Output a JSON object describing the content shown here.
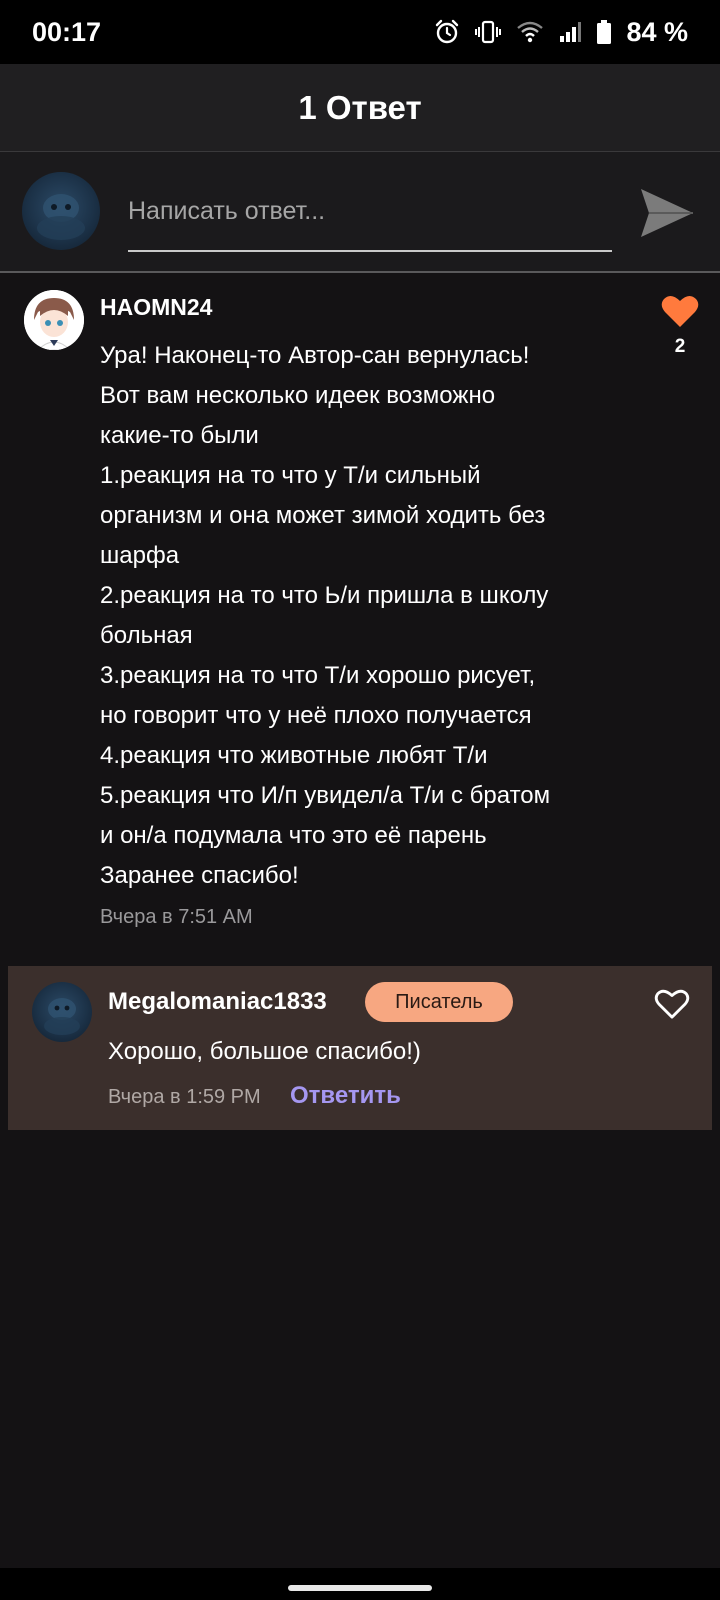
{
  "status_bar": {
    "time": "00:17",
    "battery": "84 %",
    "icons": [
      "alarm-icon",
      "vibrate-icon",
      "wifi-icon",
      "signal-icon",
      "battery-icon"
    ]
  },
  "header": {
    "title": "1 Ответ"
  },
  "reply_bar": {
    "placeholder": "Написать ответ...",
    "send_icon": "send-icon"
  },
  "comment": {
    "author": "HAOMN24",
    "likes": "2",
    "like_icon": "heart-filled-icon",
    "like_color": "#ff7a3d",
    "lines": [
      "Ура! Наконец-то Автор-сан вернулась!",
      "Вот вам несколько идеек возможно",
      "какие-то были",
      "1.реакция на то что у Т/и сильный",
      "организм и она может зимой ходить без",
      "шарфа",
      "2.реакция на то что Ь/и пришла в школу",
      "больная",
      "3.реакция на то что Т/и хорошо рисует,",
      "но говорит что у неё плохо получается",
      "4.реакция что животные любят Т/и",
      "5.реакция что И/п увидел/а Т/и с братом",
      "и он/а подумала что это её парень",
      "Заранее спасибо!"
    ],
    "time": "Вчера в 7:51 AM"
  },
  "reply": {
    "author": "Megalomaniac1833",
    "badge": "Писатель",
    "badge_color": "#f7a781",
    "text": "Хорошо, большое спасибо!)",
    "time": "Вчера в 1:59 PM",
    "reply_link": "Ответить",
    "link_color": "#a597f0",
    "like_icon": "heart-outline-icon",
    "card_color": "#3b2f2c"
  }
}
